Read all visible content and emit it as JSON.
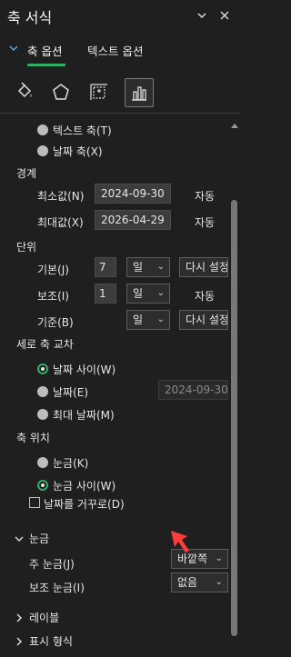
{
  "title": "축 서식",
  "tabs": {
    "axis_options": "축 옵션",
    "text_options": "텍스트 옵션"
  },
  "axis_type": {
    "text_axis": "텍스트 축(T)",
    "date_axis": "날짜 축(X)"
  },
  "bounds": {
    "header": "경계",
    "min_label": "최소값(N)",
    "min_value": "2024-09-30",
    "min_auto": "자동",
    "max_label": "최대값(X)",
    "max_value": "2026-04-29",
    "max_auto": "자동"
  },
  "units": {
    "header": "단위",
    "major_label": "기본(J)",
    "major_value": "7",
    "major_unit": "일",
    "major_reset": "다시 설정",
    "minor_label": "보조(I)",
    "minor_value": "1",
    "minor_unit": "일",
    "minor_auto": "자동",
    "base_label": "기준(B)",
    "base_unit": "일",
    "base_reset": "다시 설정"
  },
  "crosses": {
    "header": "세로 축 교차",
    "between_dates": "날짜 사이(W)",
    "at_date": "날짜(E)",
    "at_date_value": "2024-09-30",
    "at_max_date": "최대 날짜(M)"
  },
  "axis_position": {
    "header": "축 위치",
    "on_tick_marks": "눈금(K)",
    "between_tick_marks": "눈금 사이(W)",
    "reverse_order": "날짜를 거꾸로(D)"
  },
  "tick_marks": {
    "header": "눈금",
    "major_label": "주 눈금(J)",
    "major_value": "바깥쪽",
    "minor_label": "보조 눈금(I)",
    "minor_value": "없음"
  },
  "labels": {
    "header": "레이블"
  },
  "number": {
    "header": "표시 형식"
  },
  "colors": {
    "accent": "#2fae66",
    "arrow": "#ff3b3b"
  }
}
